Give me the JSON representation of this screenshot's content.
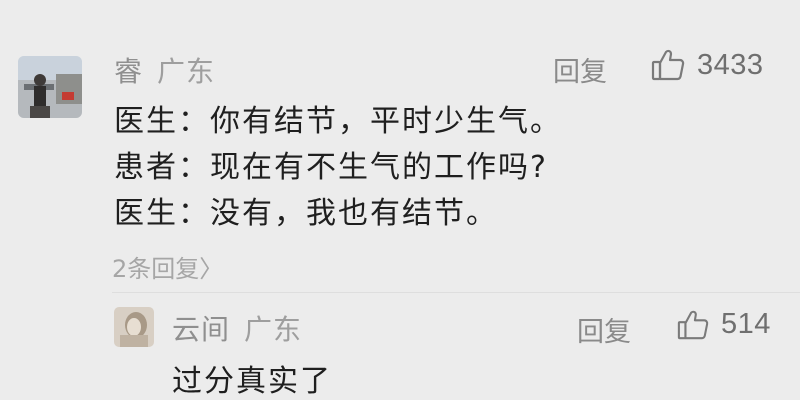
{
  "comment": {
    "author": "睿",
    "location": "广东",
    "reply_label": "回复",
    "like_count": "3433",
    "lines": [
      "医生：你有结节，平时少生气。",
      "患者：现在有不生气的工作吗?",
      "医生：没有，我也有结节。"
    ],
    "more_replies": "2条回复〉"
  },
  "reply": {
    "author": "云间",
    "location": "广东",
    "reply_label": "回复",
    "like_count": "514",
    "text": "过分真实了"
  },
  "icons": {
    "like": "thumbs-up-icon"
  },
  "colors": {
    "background": "#ececec",
    "meta_text": "#9a9a9a",
    "body_text": "#1f1f1f"
  }
}
